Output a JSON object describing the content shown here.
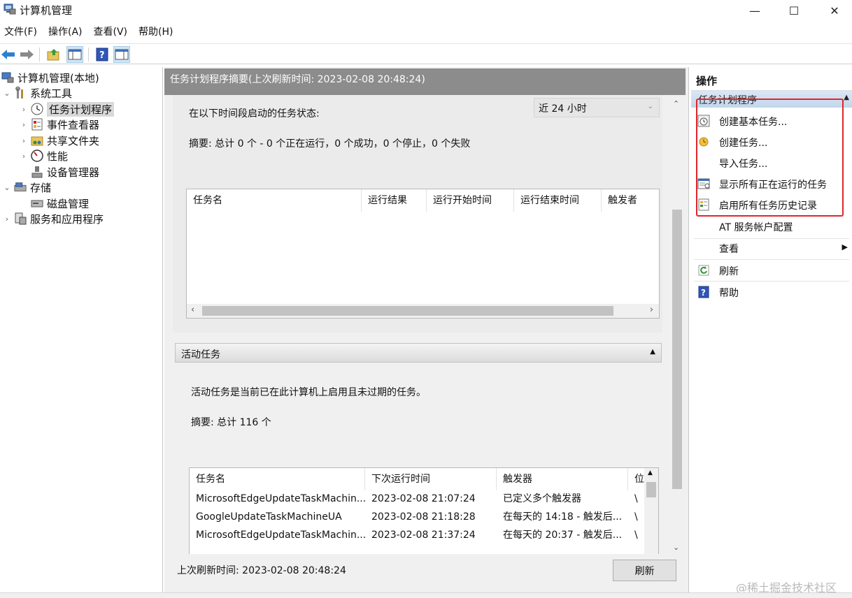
{
  "window": {
    "title": "计算机管理",
    "minimize": "—",
    "maximize": "☐",
    "close": "✕"
  },
  "menu": [
    "文件(F)",
    "操作(A)",
    "查看(V)",
    "帮助(H)"
  ],
  "tree": {
    "root": "计算机管理(本地)",
    "system_tools": "系统工具",
    "task_scheduler": "任务计划程序",
    "event_viewer": "事件查看器",
    "shared_folders": "共享文件夹",
    "performance": "性能",
    "device_manager": "设备管理器",
    "storage": "存储",
    "disk_management": "磁盘管理",
    "services_apps": "服务和应用程序"
  },
  "center": {
    "header": "任务计划程序摘要(上次刷新时间: 2023-02-08 20:48:24)",
    "status_label": "在以下时间段启动的任务状态:",
    "period_select": "近 24 小时",
    "summary": "摘要: 总计 0 个 - 0 个正在运行，0 个成功，0 个停止，0 个失败",
    "status_columns": [
      "任务名",
      "运行结果",
      "运行开始时间",
      "运行结束时间",
      "触发者"
    ],
    "active_section": "活动任务",
    "active_desc": "活动任务是当前已在此计算机上启用且未过期的任务。",
    "active_summary": "摘要: 总计 116 个",
    "active_columns": [
      "任务名",
      "下次运行时间",
      "触发器",
      "位"
    ],
    "active_rows": [
      [
        "MicrosoftEdgeUpdateTaskMachin...",
        "2023-02-08 21:07:24",
        "已定义多个触发器",
        "\\"
      ],
      [
        "GoogleUpdateTaskMachineUA",
        "2023-02-08 21:18:28",
        "在每天的 14:18 - 触发后...",
        "\\"
      ],
      [
        "MicrosoftEdgeUpdateTaskMachin...",
        "2023-02-08 21:37:24",
        "在每天的 20:37 - 触发后...",
        "\\"
      ]
    ],
    "last_refresh": "上次刷新时间: 2023-02-08 20:48:24",
    "refresh_button": "刷新"
  },
  "actions": {
    "title": "操作",
    "group": "任务计划程序",
    "items": [
      {
        "label": "创建基本任务...",
        "icon": "basic-task-icon"
      },
      {
        "label": "创建任务...",
        "icon": "create-task-icon"
      },
      {
        "label": "导入任务...",
        "icon": "none"
      },
      {
        "label": "显示所有正在运行的任务",
        "icon": "running-tasks-icon"
      },
      {
        "label": "启用所有任务历史记录",
        "icon": "history-icon"
      },
      {
        "label": "AT 服务帐户配置",
        "icon": "none"
      },
      {
        "label": "查看",
        "icon": "none"
      },
      {
        "label": "刷新",
        "icon": "refresh-icon"
      },
      {
        "label": "帮助",
        "icon": "help-icon"
      }
    ]
  },
  "watermark": "@稀土掘金技术社区",
  "colors": {
    "highlight_box": "#e0252b",
    "header_gray": "#8c8c8c",
    "actions_group_bg": "#c3d6ea"
  }
}
